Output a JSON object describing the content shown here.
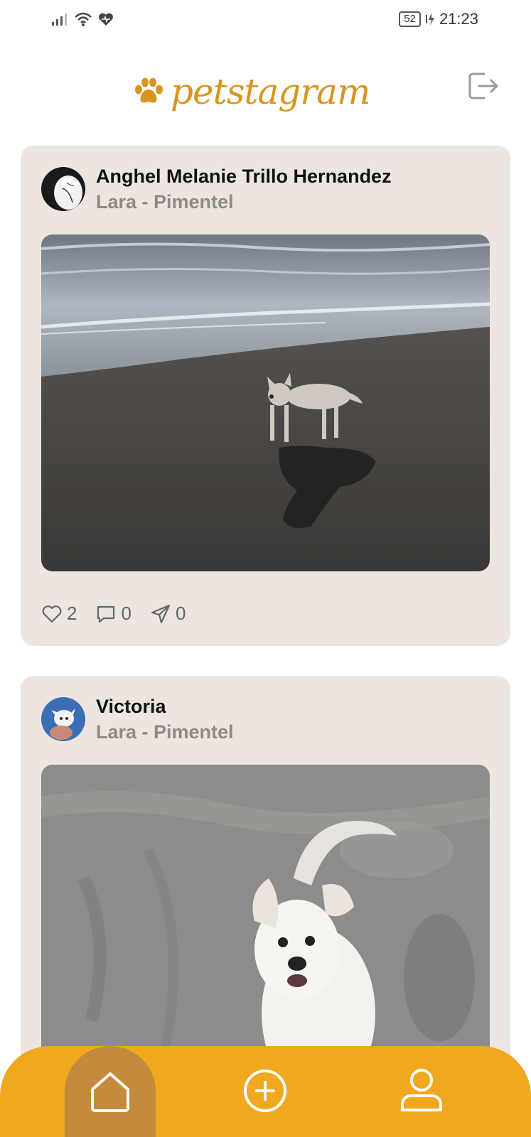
{
  "status_bar": {
    "battery": "52",
    "time": "21:23"
  },
  "header": {
    "app_name": "petstagram"
  },
  "posts": [
    {
      "author": "Anghel Melanie Trillo Hernandez",
      "location": "Lara - Pimentel",
      "likes": "2",
      "comments": "0",
      "shares": "0"
    },
    {
      "author": "Victoria",
      "location": "Lara - Pimentel"
    }
  ],
  "colors": {
    "brand": "#D9951F",
    "nav_bar": "#F0A81E",
    "nav_active": "#C58A3B",
    "card_bg": "#EDE6E0"
  },
  "icons": {
    "logout": "logout-icon",
    "like": "heart-icon",
    "comment": "comment-icon",
    "share": "send-icon",
    "home": "home-icon",
    "add": "add-circle-icon",
    "profile": "user-icon"
  }
}
